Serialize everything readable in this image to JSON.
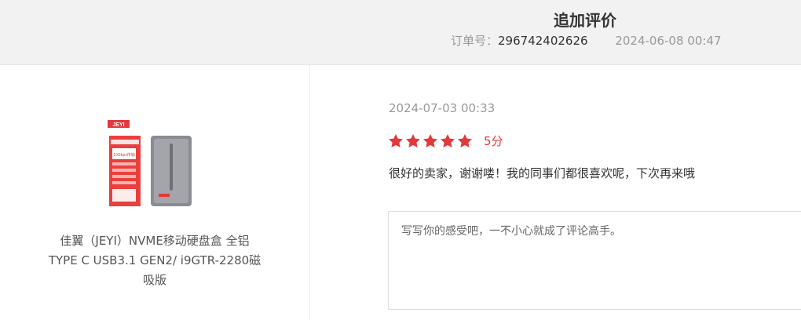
{
  "header": {
    "title": "追加评价",
    "order_label": "订单号：",
    "order_number": "296742402626",
    "order_time": "2024-06-08 00:47"
  },
  "product": {
    "name_line1": "佳翼（JEYI）NVME移动硬盘盒 全铝",
    "name_line2": "TYPE C USB3.1 GEN2/ i9GTR-2280磁",
    "name_line3": "吸版",
    "image_brand": "JEYI",
    "image_badge": "10Gbps传输"
  },
  "review": {
    "date": "2024-07-03 00:33",
    "stars": 5,
    "score_text": "5分",
    "text": "很好的卖家，谢谢喽！我的同事们都很喜欢呢，下次再来哦"
  },
  "reply": {
    "placeholder": "写写你的感受吧，一不小心就成了评论高手。",
    "value": ""
  },
  "colors": {
    "accent": "#e4393c",
    "header_bg": "#f2f2f2",
    "muted_text": "#999999"
  }
}
